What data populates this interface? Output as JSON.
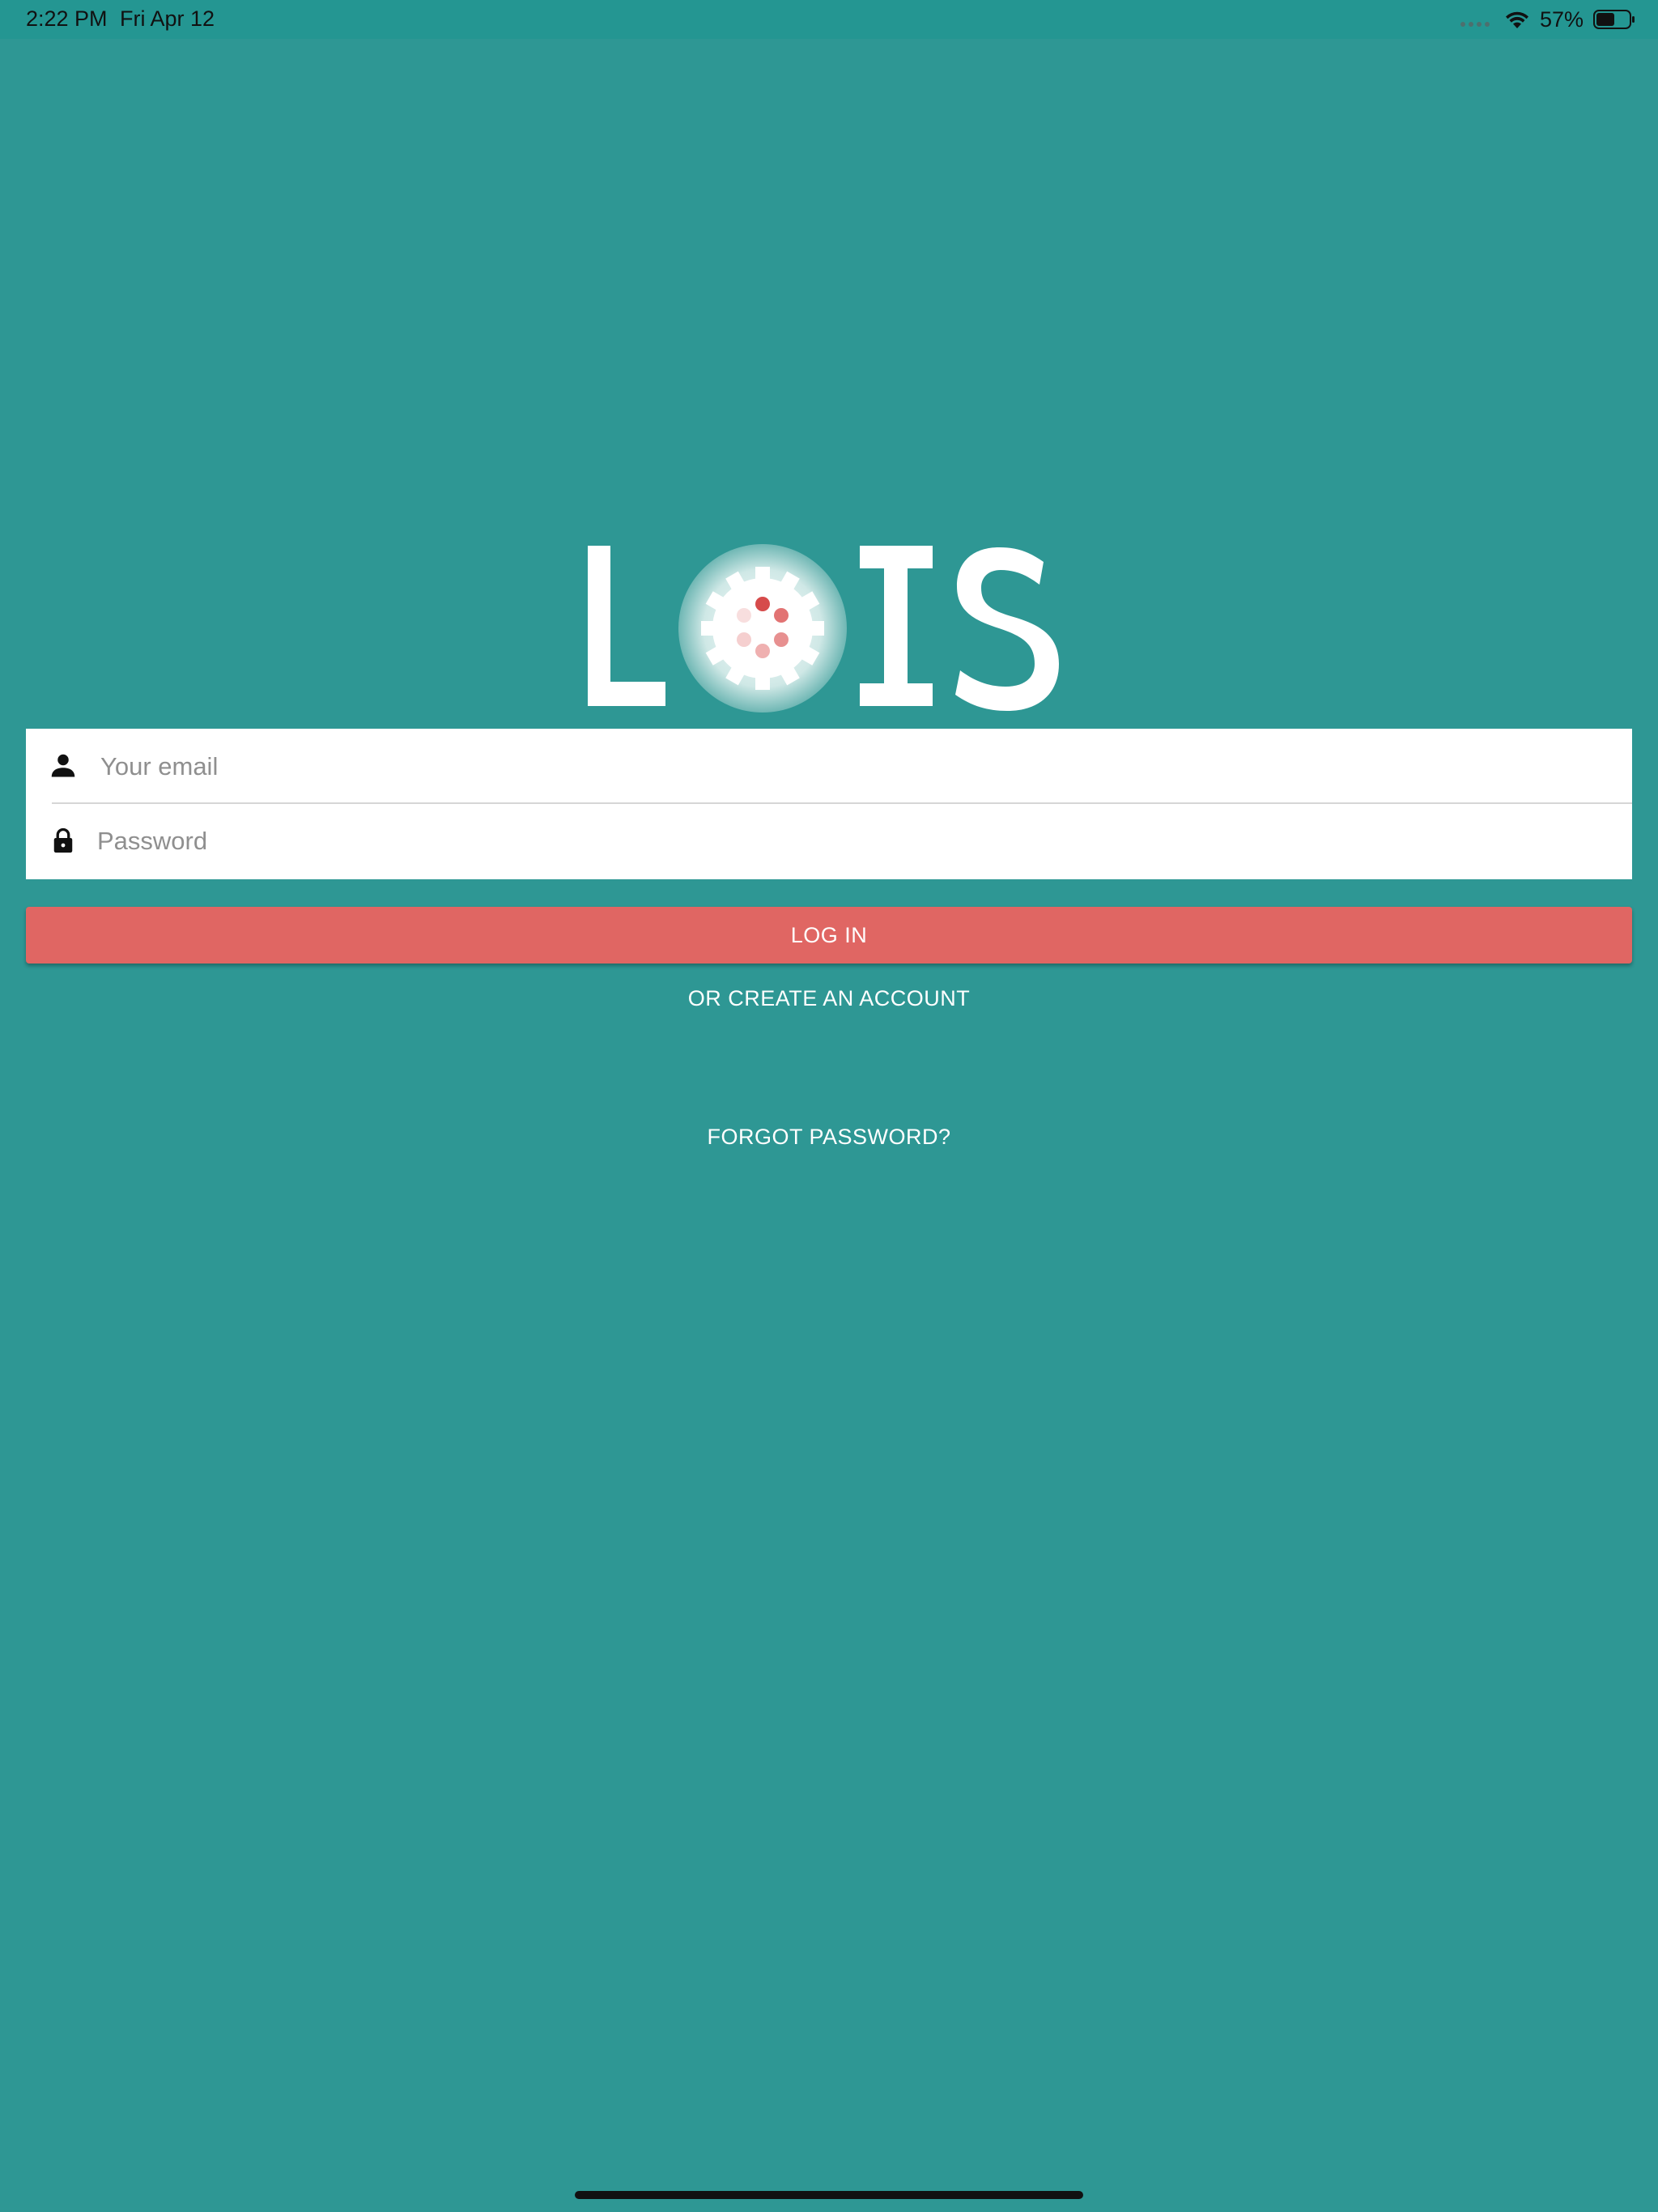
{
  "status_bar": {
    "time": "2:22 PM",
    "date": "Fri Apr 12",
    "battery_percent": "57%",
    "battery_level": 0.57,
    "icons": [
      "cellular-signal-icon",
      "wifi-icon",
      "battery-icon"
    ]
  },
  "logo": {
    "text": "LOIS",
    "icon": "gear-logo-icon"
  },
  "login_form": {
    "email_placeholder": "Your email",
    "email_value": "",
    "email_icon": "person-icon",
    "password_placeholder": "Password",
    "password_value": "",
    "password_icon": "lock-icon"
  },
  "actions": {
    "login_label": "LOG IN",
    "create_account_label": "OR CREATE AN ACCOUNT",
    "forgot_password_label": "FORGOT PASSWORD?"
  },
  "colors": {
    "background": "#2e9794",
    "status_bar": "#249692",
    "login_button": "#e06663",
    "text_light": "#ffffff"
  }
}
